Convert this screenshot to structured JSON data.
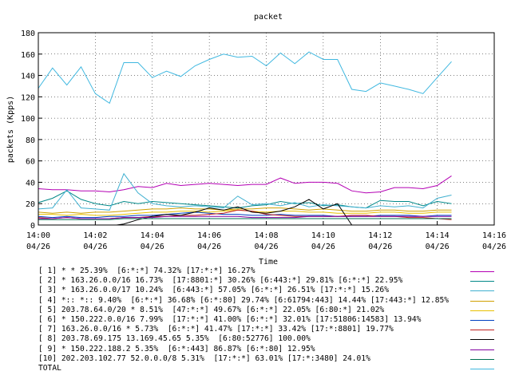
{
  "chart_data": {
    "type": "line",
    "title": "packet",
    "xlabel": "Time",
    "ylabel": "packets (Kpps)",
    "ylim": [
      0,
      180
    ],
    "yticks": [
      0,
      20,
      40,
      60,
      80,
      100,
      120,
      140,
      160,
      180
    ],
    "xlim": [
      "14:00",
      "14:16"
    ],
    "xticks": [
      {
        "time": "14:00",
        "date": "04/26"
      },
      {
        "time": "14:02",
        "date": "04/26"
      },
      {
        "time": "14:04",
        "date": "04/26"
      },
      {
        "time": "14:06",
        "date": "04/26"
      },
      {
        "time": "14:08",
        "date": "04/26"
      },
      {
        "time": "14:10",
        "date": "04/26"
      },
      {
        "time": "14:12",
        "date": "04/26"
      },
      {
        "time": "14:14",
        "date": "04/26"
      },
      {
        "time": "14:16",
        "date": "04/26"
      }
    ],
    "grid": true,
    "legend_position": "bottom",
    "series": [
      {
        "label": "[ 1] * * 25.39%  [6:*:*] 74.32% [17:*:*] 16.27%",
        "color": "#b400b4",
        "x": [
          "14:00",
          "14:00:30",
          "14:01",
          "14:01:30",
          "14:02",
          "14:02:30",
          "14:03",
          "14:03:30",
          "14:04",
          "14:04:30",
          "14:05",
          "14:05:30",
          "14:06",
          "14:06:30",
          "14:07",
          "14:07:30",
          "14:08",
          "14:08:30",
          "14:09",
          "14:09:30",
          "14:10",
          "14:10:30",
          "14:11",
          "14:11:30",
          "14:12",
          "14:12:30",
          "14:13",
          "14:13:30",
          "14:14",
          "14:14:30"
        ],
        "y": [
          34,
          33,
          33,
          32,
          32,
          31,
          33,
          36,
          35,
          39,
          37,
          38,
          39,
          38,
          37,
          38,
          38,
          44,
          39,
          40,
          40,
          39,
          32,
          30,
          31,
          35,
          35,
          34,
          37,
          46
        ]
      },
      {
        "label": "[ 2] * 163.26.0.0/16 16.73%  [17:8801:*] 30.26% [6:443:*] 29.81% [6:*:*] 22.95%",
        "color": "#008888",
        "x": [
          "14:00",
          "14:00:30",
          "14:01",
          "14:01:30",
          "14:02",
          "14:02:30",
          "14:03",
          "14:03:30",
          "14:04",
          "14:04:30",
          "14:05",
          "14:05:30",
          "14:06",
          "14:06:30",
          "14:07",
          "14:07:30",
          "14:08",
          "14:08:30",
          "14:09",
          "14:09:30",
          "14:10",
          "14:10:30",
          "14:11",
          "14:11:30",
          "14:12",
          "14:12:30",
          "14:13",
          "14:13:30",
          "14:14",
          "14:14:30"
        ],
        "y": [
          21,
          25,
          32,
          24,
          20,
          18,
          22,
          20,
          22,
          21,
          20,
          19,
          18,
          17,
          16,
          18,
          19,
          22,
          20,
          21,
          18,
          19,
          17,
          16,
          23,
          22,
          22,
          18,
          22,
          20
        ]
      },
      {
        "label": "[ 3] * 163.26.0.0/17 10.24%  [6:443:*] 57.05% [6:*:*] 26.51% [17:*:*] 15.26%",
        "color": "#40b0d0",
        "x": [
          "14:00",
          "14:00:30",
          "14:01",
          "14:01:30",
          "14:02",
          "14:02:30",
          "14:03",
          "14:03:30",
          "14:04",
          "14:04:30",
          "14:05",
          "14:05:30",
          "14:06",
          "14:06:30",
          "14:07",
          "14:07:30",
          "14:08",
          "14:08:30",
          "14:09",
          "14:09:30",
          "14:10",
          "14:10:30",
          "14:11",
          "14:11:30",
          "14:12",
          "14:12:30",
          "14:13",
          "14:13:30",
          "14:14",
          "14:14:30"
        ],
        "y": [
          15,
          16,
          33,
          16,
          15,
          14,
          48,
          30,
          20,
          18,
          17,
          18,
          17,
          16,
          27,
          19,
          20,
          18,
          21,
          17,
          19,
          18,
          17,
          16,
          18,
          17,
          18,
          16,
          25,
          28
        ]
      },
      {
        "label": "[ 4] *:: *:: 9.40%  [6:*:*] 36.68% [6:*:80] 29.74% [6:61794:443] 14.44% [17:443:*] 12.85%",
        "color": "#d0a000",
        "x": [
          "14:00",
          "14:00:30",
          "14:01",
          "14:01:30",
          "14:02",
          "14:02:30",
          "14:03",
          "14:03:30",
          "14:04",
          "14:04:30",
          "14:05",
          "14:05:30",
          "14:06",
          "14:06:30",
          "14:07",
          "14:07:30",
          "14:08",
          "14:08:30",
          "14:09",
          "14:09:30",
          "14:10",
          "14:10:30",
          "14:11",
          "14:11:30",
          "14:12",
          "14:12:30",
          "14:13",
          "14:13:30",
          "14:14",
          "14:14:30"
        ],
        "y": [
          12,
          11,
          12,
          11,
          12,
          12,
          13,
          14,
          15,
          15,
          16,
          15,
          15,
          14,
          15,
          15,
          16,
          16,
          15,
          14,
          15,
          14,
          13,
          13,
          14,
          14,
          13,
          13,
          14,
          14
        ]
      },
      {
        "label": "[ 5] 203.78.64.0/20 * 8.51%  [47:*:*] 49.67% [6:*:*] 22.05% [6:80:*] 21.02%",
        "color": "#e8c000",
        "x": [
          "14:00",
          "14:00:30",
          "14:01",
          "14:01:30",
          "14:02",
          "14:02:30",
          "14:03",
          "14:03:30",
          "14:04",
          "14:04:30",
          "14:05",
          "14:05:30",
          "14:06",
          "14:06:30",
          "14:07",
          "14:07:30",
          "14:08",
          "14:08:30",
          "14:09",
          "14:09:30",
          "14:10",
          "14:10:30",
          "14:11",
          "14:11:30",
          "14:12",
          "14:12:30",
          "14:13",
          "14:13:30",
          "14:14",
          "14:14:30"
        ],
        "y": [
          10,
          10,
          9,
          10,
          9,
          9,
          10,
          11,
          12,
          12,
          13,
          13,
          12,
          13,
          14,
          13,
          12,
          13,
          13,
          12,
          12,
          11,
          11,
          11,
          12,
          12,
          11,
          11,
          12,
          12
        ]
      },
      {
        "label": "[ 6] * 150.222.0.0/16 7.99%  [17:*:*] 41.00% [6:*:*] 32.01% [17:51806:14583] 13.94%",
        "color": "#0040c0",
        "x": [
          "14:00",
          "14:00:30",
          "14:01",
          "14:01:30",
          "14:02",
          "14:02:30",
          "14:03",
          "14:03:30",
          "14:04",
          "14:04:30",
          "14:05",
          "14:05:30",
          "14:06",
          "14:06:30",
          "14:07",
          "14:07:30",
          "14:08",
          "14:08:30",
          "14:09",
          "14:09:30",
          "14:10",
          "14:10:30",
          "14:11",
          "14:11:30",
          "14:12",
          "14:12:30",
          "14:13",
          "14:13:30",
          "14:14",
          "14:14:30"
        ],
        "y": [
          8,
          7,
          8,
          7,
          7,
          8,
          8,
          9,
          9,
          10,
          11,
          12,
          11,
          10,
          10,
          9,
          9,
          10,
          9,
          9,
          9,
          8,
          8,
          8,
          9,
          9,
          9,
          8,
          9,
          9
        ]
      },
      {
        "label": "[ 7] 163.26.0.0/16 * 5.73%  [6:*:*] 41.47% [17:*:*] 33.42% [17:*:8801] 19.77%",
        "color": "#c02020",
        "x": [
          "14:00",
          "14:00:30",
          "14:01",
          "14:01:30",
          "14:02",
          "14:02:30",
          "14:03",
          "14:03:30",
          "14:04",
          "14:04:30",
          "14:05",
          "14:05:30",
          "14:06",
          "14:06:30",
          "14:07",
          "14:07:30",
          "14:08",
          "14:08:30",
          "14:09",
          "14:09:30",
          "14:10",
          "14:10:30",
          "14:11",
          "14:11:30",
          "14:12",
          "14:12:30",
          "14:13",
          "14:13:30",
          "14:14",
          "14:14:30"
        ],
        "y": [
          7,
          6,
          7,
          6,
          6,
          6,
          7,
          7,
          8,
          8,
          9,
          9,
          10,
          11,
          14,
          13,
          10,
          9,
          8,
          8,
          8,
          8,
          9,
          9,
          8,
          8,
          7,
          7,
          6,
          5
        ]
      },
      {
        "label": "[ 8] 203.78.69.175 13.169.45.65 5.35%  [6:80:52776] 100.00%",
        "color": "#000000",
        "x": [
          "14:02:45",
          "14:03",
          "14:03:30",
          "14:04",
          "14:04:30",
          "14:05",
          "14:05:30",
          "14:06",
          "14:06:30",
          "14:07",
          "14:07:30",
          "14:08",
          "14:08:30",
          "14:09",
          "14:09:30",
          "14:10",
          "14:10:30",
          "14:11"
        ],
        "y": [
          0,
          1,
          5,
          8,
          10,
          9,
          12,
          16,
          14,
          17,
          12,
          11,
          13,
          17,
          24,
          15,
          20,
          0
        ]
      },
      {
        "label": "[ 9] * 150.222.188.2 5.35%  [6:*:443] 86.87% [6:*:80] 12.95%",
        "color": "#8000a0",
        "x": [
          "14:00",
          "14:00:30",
          "14:01",
          "14:01:30",
          "14:02",
          "14:02:30",
          "14:03",
          "14:03:30",
          "14:04",
          "14:04:30",
          "14:05",
          "14:05:30",
          "14:06",
          "14:06:30",
          "14:07",
          "14:07:30",
          "14:08",
          "14:08:30",
          "14:09",
          "14:09:30",
          "14:10",
          "14:10:30",
          "14:11",
          "14:11:30",
          "14:12",
          "14:12:30",
          "14:13",
          "14:13:30",
          "14:14",
          "14:14:30"
        ],
        "y": [
          6,
          6,
          7,
          6,
          6,
          6,
          7,
          7,
          7,
          8,
          8,
          8,
          8,
          8,
          8,
          7,
          7,
          7,
          7,
          8,
          8,
          8,
          8,
          8,
          8,
          8,
          8,
          8,
          8,
          8
        ]
      },
      {
        "label": "[10] 202.203.102.77 52.0.0.0/8 5.31%  [17:*:*] 63.01% [17:*:3480] 24.01%",
        "color": "#007050",
        "x": [
          "14:00",
          "14:00:30",
          "14:01",
          "14:01:30",
          "14:02",
          "14:02:30",
          "14:03",
          "14:03:30",
          "14:04",
          "14:04:30",
          "14:05",
          "14:05:30",
          "14:06",
          "14:06:30",
          "14:07",
          "14:07:30",
          "14:08",
          "14:08:30",
          "14:09",
          "14:09:30",
          "14:10",
          "14:10:30",
          "14:11",
          "14:11:30",
          "14:12",
          "14:12:30",
          "14:13",
          "14:13:30",
          "14:14",
          "14:14:30"
        ],
        "y": [
          5,
          5,
          5,
          5,
          5,
          5,
          6,
          6,
          6,
          6,
          6,
          6,
          6,
          6,
          6,
          6,
          6,
          6,
          6,
          6,
          6,
          6,
          6,
          6,
          6,
          6,
          6,
          6,
          6,
          6
        ]
      },
      {
        "label": "TOTAL",
        "color": "#40b8e0",
        "x": [
          "14:00",
          "14:00:30",
          "14:01",
          "14:01:30",
          "14:02",
          "14:02:30",
          "14:03",
          "14:03:30",
          "14:04",
          "14:04:30",
          "14:05",
          "14:05:30",
          "14:06",
          "14:06:30",
          "14:07",
          "14:07:30",
          "14:08",
          "14:08:30",
          "14:09",
          "14:09:30",
          "14:10",
          "14:10:30",
          "14:11",
          "14:11:30",
          "14:12",
          "14:12:30",
          "14:13",
          "14:13:30",
          "14:14",
          "14:14:30"
        ],
        "y": [
          128,
          147,
          131,
          148,
          123,
          114,
          152,
          152,
          138,
          144,
          139,
          149,
          155,
          160,
          157,
          158,
          149,
          161,
          151,
          162,
          155,
          155,
          127,
          125,
          133,
          130,
          127,
          123,
          138,
          153
        ]
      }
    ]
  }
}
